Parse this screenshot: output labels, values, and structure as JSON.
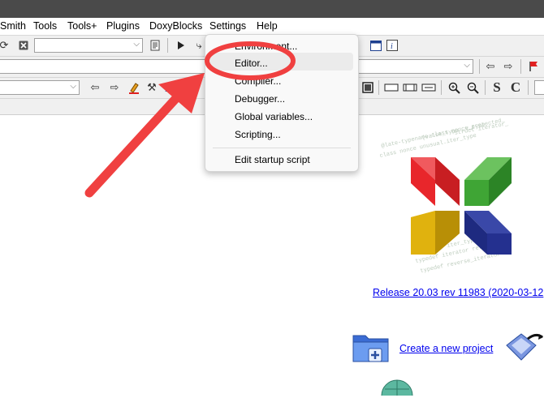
{
  "menubar": {
    "items": [
      "Smith",
      "Tools",
      "Tools+",
      "Plugins",
      "DoxyBlocks",
      "Settings",
      "Help"
    ]
  },
  "settings_menu": {
    "items": [
      "Environment...",
      "Editor...",
      "Compiler...",
      "Debugger...",
      "Global variables...",
      "Scripting..."
    ],
    "startup_item": "Edit startup script",
    "highlighted": "Editor..."
  },
  "toolbar": {
    "style_bold_label": "S",
    "style_code_label": "C"
  },
  "start_page": {
    "release_link": "Release 20.03 rev 11983 (2020-03-12",
    "create_project_link": "Create a new project"
  },
  "annotation": {
    "color": "#f04040"
  },
  "colors": {
    "logo_red": "#e8262b",
    "logo_green": "#3fa535",
    "logo_yellow": "#e0b20e",
    "logo_blue": "#24308f",
    "link": "#0000ee"
  }
}
